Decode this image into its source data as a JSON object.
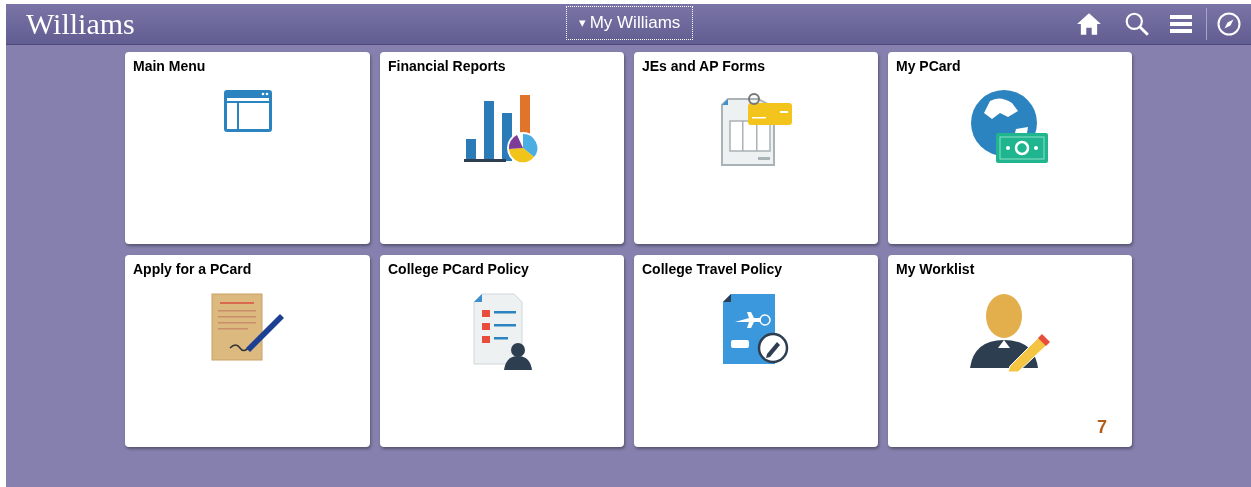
{
  "header": {
    "logo": "Williams",
    "title": "My Williams",
    "dropdown_caret": "▾"
  },
  "tiles": [
    {
      "title": "Main Menu"
    },
    {
      "title": "Financial Reports"
    },
    {
      "title": "JEs and AP Forms"
    },
    {
      "title": "My PCard"
    },
    {
      "title": "Apply for a PCard"
    },
    {
      "title": "College PCard Policy"
    },
    {
      "title": "College Travel Policy"
    },
    {
      "title": "My Worklist",
      "badge": "7"
    }
  ]
}
